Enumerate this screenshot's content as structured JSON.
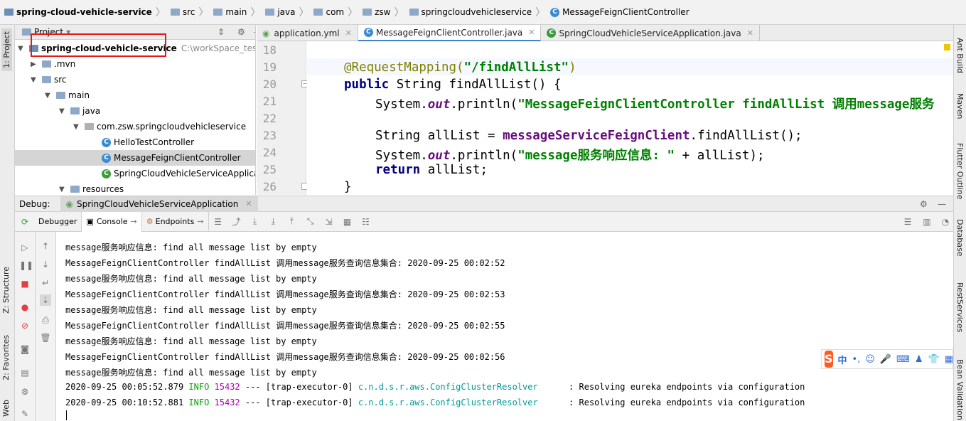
{
  "breadcrumb": [
    "spring-cloud-vehicle-service",
    "src",
    "main",
    "java",
    "com",
    "zsw",
    "springcloudvehicleservice",
    "MessageFeignClientController"
  ],
  "left_tabs": {
    "project": "1: Project",
    "structure": "Z: Structure",
    "favorites": "2: Favorites",
    "web": "Web"
  },
  "right_tabs": {
    "ant": "Ant Build",
    "maven": "Maven",
    "flutter": "Flutter Outline",
    "database": "Database",
    "rest": "RestServices",
    "bean": "Bean Validation"
  },
  "project": {
    "header": "Project",
    "root": "spring-cloud-vehicle-service",
    "root_path": "C:\\workSpace_test\\sprin",
    "mvn": ".mvn",
    "src": "src",
    "main": "main",
    "java": "java",
    "package": "com.zsw.springcloudvehicleservice",
    "c1": "HelloTestController",
    "c2": "MessageFeignClientController",
    "c3": "SpringCloudVehicleServiceApplication",
    "resources": "resources"
  },
  "tabs": [
    {
      "label": "application.yml"
    },
    {
      "label": "MessageFeignClientController.java"
    },
    {
      "label": "SpringCloudVehicleServiceApplication.java"
    }
  ],
  "lines": [
    "18",
    "19",
    "20",
    "21",
    "22",
    "23",
    "24",
    "25",
    "26"
  ],
  "code": {
    "l19_ann": "@RequestMapping(",
    "l19_str": "\"/findAllList\"",
    "l19_end": ")",
    "l20_kw": "public",
    "l20_rest": " String findAllList() {",
    "l21_a": "System.",
    "l21_fld": "out",
    "l21_b": ".println(",
    "l21_str": "\"MessageFeignClientController findAllList 调用message服务",
    "l23_a": "String allList = ",
    "l23_b": "messageServiceFeignClient",
    "l23_c": ".findAllList();",
    "l24_a": "System.",
    "l24_fld": "out",
    "l24_b": ".println(",
    "l24_str": "\"message服务响应信息: \"",
    "l24_c": " + allList);",
    "l25_kw": "return",
    "l25_rest": " allList;",
    "l26": "}"
  },
  "debug": {
    "label": "Debug:",
    "config": "SpringCloudVehicleServiceApplication",
    "tab_debugger": "Debugger",
    "tab_console": "Console",
    "tab_endpoints": "Endpoints"
  },
  "console": [
    "message服务响应信息: find all message list by empty",
    "MessageFeignClientController findAllList 调用message服务查询信息集合: 2020-09-25 00:02:52",
    "message服务响应信息: find all message list by empty",
    "MessageFeignClientController findAllList 调用message服务查询信息集合: 2020-09-25 00:02:53",
    "message服务响应信息: find all message list by empty",
    "MessageFeignClientController findAllList 调用message服务查询信息集合: 2020-09-25 00:02:55",
    "message服务响应信息: find all message list by empty",
    "MessageFeignClientController findAllList 调用message服务查询信息集合: 2020-09-25 00:02:56",
    "message服务响应信息: find all message list by empty"
  ],
  "log1": {
    "ts": "2020-09-25 00:05:52.879 ",
    "level": "INFO",
    "pid": "15432",
    "mid": " --- [trap-executor-0] ",
    "cls": "c.n.d.s.r.aws.ConfigClusterResolver      ",
    "msg": ": Resolving eureka endpoints via configuration"
  },
  "log2": {
    "ts": "2020-09-25 00:10:52.881 ",
    "level": "INFO",
    "pid": "15432",
    "mid": " --- [trap-executor-0] ",
    "cls": "c.n.d.s.r.aws.ConfigClusterResolver      ",
    "msg": ": Resolving eureka endpoints via configuration"
  },
  "ime": {
    "logo": "S",
    "lang": "中"
  }
}
